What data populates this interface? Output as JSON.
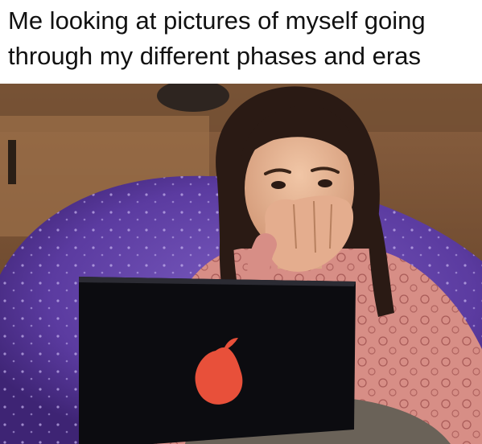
{
  "caption": {
    "line1": "Me looking at pictures of myself going",
    "line2": "through my different phases and eras"
  },
  "photo": {
    "subject_icon": "shocked-girl-with-laptop",
    "laptop_logo_icon": "pear-icon",
    "colors": {
      "beanbag": "#5b3ba0",
      "wall": "#7a5233",
      "shirt": "#d78e86",
      "hair": "#2a1a14",
      "laptop": "#0c0c10",
      "pear_logo": "#e8503a"
    }
  }
}
